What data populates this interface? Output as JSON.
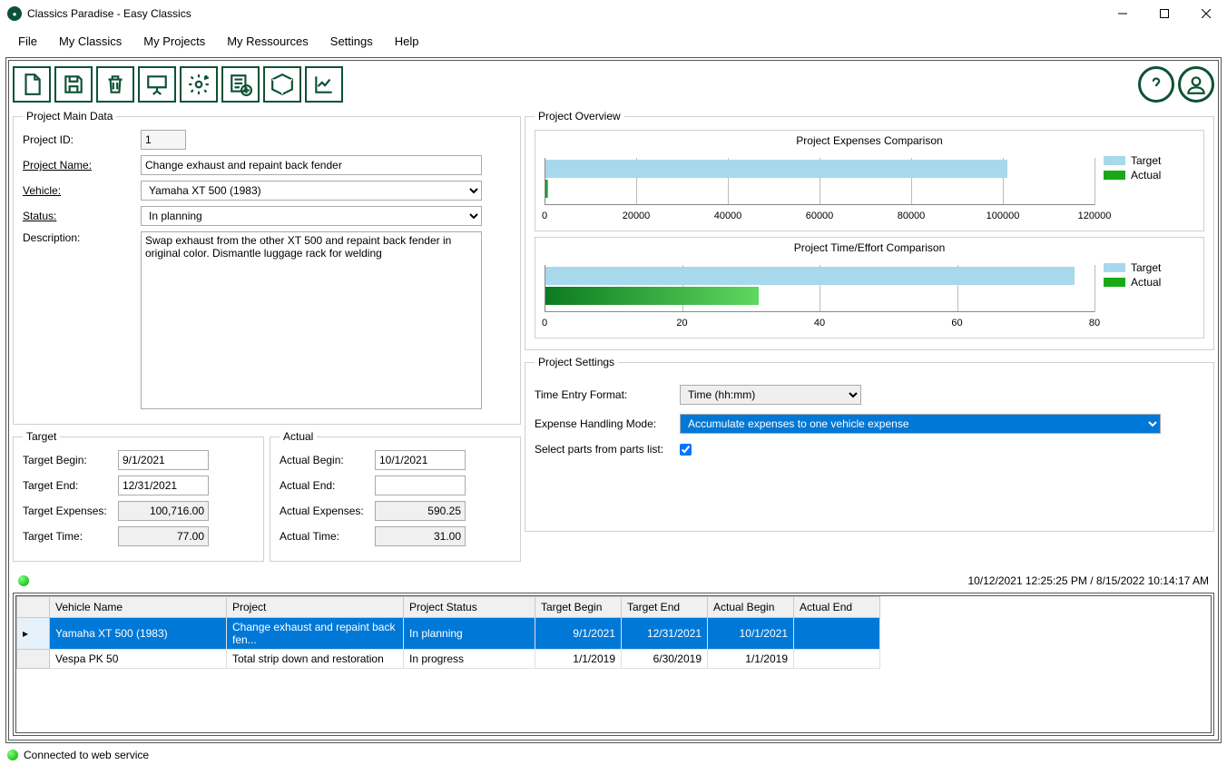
{
  "window": {
    "title": "Classics Paradise - Easy Classics"
  },
  "menu": {
    "file": "File",
    "my_classics": "My Classics",
    "my_projects": "My Projects",
    "my_resources": "My Ressources",
    "settings": "Settings",
    "help": "Help"
  },
  "main_data": {
    "legend": "Project Main Data",
    "project_id_label": "Project ID:",
    "project_id": "1",
    "project_name_label": "Project Name:",
    "project_name": "Change exhaust and repaint back fender",
    "vehicle_label": "Vehicle:",
    "vehicle": "Yamaha XT 500 (1983)",
    "status_label": "Status:",
    "status": "In planning",
    "description_label": "Description:",
    "description": "Swap exhaust from the other XT 500 and repaint back fender in original color. Dismantle luggage rack for welding"
  },
  "target": {
    "legend": "Target",
    "begin_label": "Target Begin:",
    "begin": "9/1/2021",
    "end_label": "Target End:",
    "end": "12/31/2021",
    "expenses_label": "Target Expenses:",
    "expenses": "100,716.00",
    "time_label": "Target Time:",
    "time": "77.00"
  },
  "actual": {
    "legend": "Actual",
    "begin_label": "Actual Begin:",
    "begin": "10/1/2021",
    "end_label": "Actual End:",
    "end": "",
    "expenses_label": "Actual Expenses:",
    "expenses": "590.25",
    "time_label": "Actual Time:",
    "time": "31.00"
  },
  "overview": {
    "legend": "Project Overview"
  },
  "chart_data": [
    {
      "type": "bar",
      "title": "Project Expenses Comparison",
      "categories": [
        "Target",
        "Actual"
      ],
      "values": [
        100716,
        590.25
      ],
      "x_ticks": [
        0,
        20000,
        40000,
        60000,
        80000,
        100000,
        120000
      ],
      "xlim": [
        0,
        120000
      ],
      "legend": {
        "target": "Target",
        "actual": "Actual"
      },
      "colors": {
        "target": "#a8d8ec",
        "actual": "#18a818"
      }
    },
    {
      "type": "bar",
      "title": "Project Time/Effort Comparison",
      "categories": [
        "Target",
        "Actual"
      ],
      "values": [
        77,
        31
      ],
      "x_ticks": [
        0,
        20,
        40,
        60,
        80
      ],
      "xlim": [
        0,
        80
      ],
      "legend": {
        "target": "Target",
        "actual": "Actual"
      },
      "colors": {
        "target": "#a8d8ec",
        "actual": "#18a818"
      }
    }
  ],
  "settings": {
    "legend": "Project Settings",
    "time_format_label": "Time Entry Format:",
    "time_format": "Time (hh:mm)",
    "expense_mode_label": "Expense Handling Mode:",
    "expense_mode": "Accumulate expenses to one vehicle expense",
    "parts_list_label": "Select parts from parts list:",
    "parts_list_checked": true
  },
  "status": {
    "timestamps": "10/12/2021 12:25:25 PM / 8/15/2022 10:14:17 AM",
    "connected": "Connected to web service"
  },
  "grid": {
    "headers": {
      "vehicle": "Vehicle Name",
      "project": "Project",
      "status": "Project Status",
      "tbegin": "Target Begin",
      "tend": "Target End",
      "abegin": "Actual Begin",
      "aend": "Actual End"
    },
    "rows": [
      {
        "vehicle": "Yamaha XT 500 (1983)",
        "project": "Change exhaust and repaint back fen...",
        "status": "In planning",
        "tbegin": "9/1/2021",
        "tend": "12/31/2021",
        "abegin": "10/1/2021",
        "aend": ""
      },
      {
        "vehicle": "Vespa PK 50",
        "project": "Total strip down and restoration",
        "status": "In progress",
        "tbegin": "1/1/2019",
        "tend": "6/30/2019",
        "abegin": "1/1/2019",
        "aend": ""
      }
    ]
  }
}
